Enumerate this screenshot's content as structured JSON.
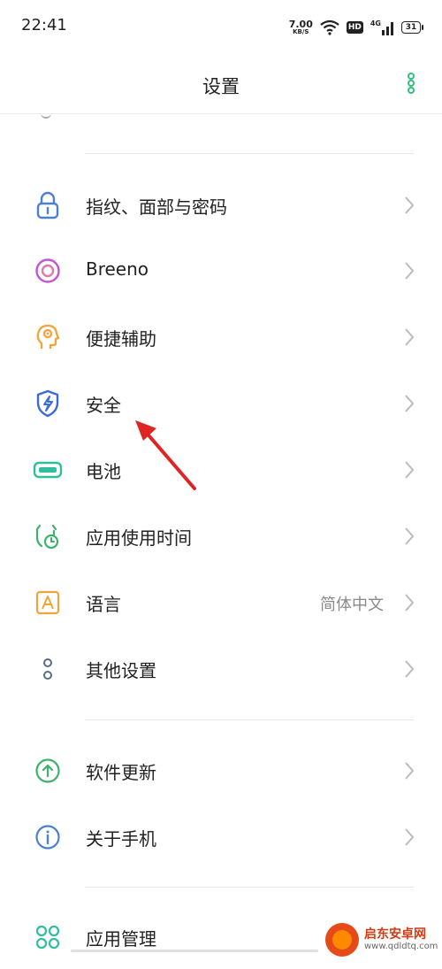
{
  "status": {
    "time": "22:41",
    "net_speed": "7.00",
    "net_unit": "KB/S",
    "hd": "HD",
    "signal": "4G",
    "battery": "31"
  },
  "header": {
    "title": "设置"
  },
  "items": [
    {
      "label": "指纹、面部与密码",
      "icon": "lock-icon",
      "color": "#4a7fd1"
    },
    {
      "label": "Breeno",
      "icon": "breeno-icon",
      "color": "#c056d6"
    },
    {
      "label": "便捷辅助",
      "icon": "assist-icon",
      "color": "#f2a33a"
    },
    {
      "label": "安全",
      "icon": "shield-icon",
      "color": "#3a6bd6"
    },
    {
      "label": "电池",
      "icon": "battery-icon",
      "color": "#2fbf9f"
    },
    {
      "label": "应用使用时间",
      "icon": "screen-time-icon",
      "color": "#3db26b"
    },
    {
      "label": "语言",
      "icon": "language-icon",
      "color": "#f2a33a",
      "value": "简体中文"
    },
    {
      "label": "其他设置",
      "icon": "other-settings-icon",
      "color": "#5a6c8a"
    },
    {
      "label": "软件更新",
      "icon": "update-icon",
      "color": "#3db26b"
    },
    {
      "label": "关于手机",
      "icon": "info-icon",
      "color": "#4a7fd1"
    },
    {
      "label": "应用管理",
      "icon": "apps-icon",
      "color": "#2fbf9f"
    }
  ],
  "watermark": {
    "name": "启东安卓网",
    "url": "www.qdldtq.com"
  }
}
